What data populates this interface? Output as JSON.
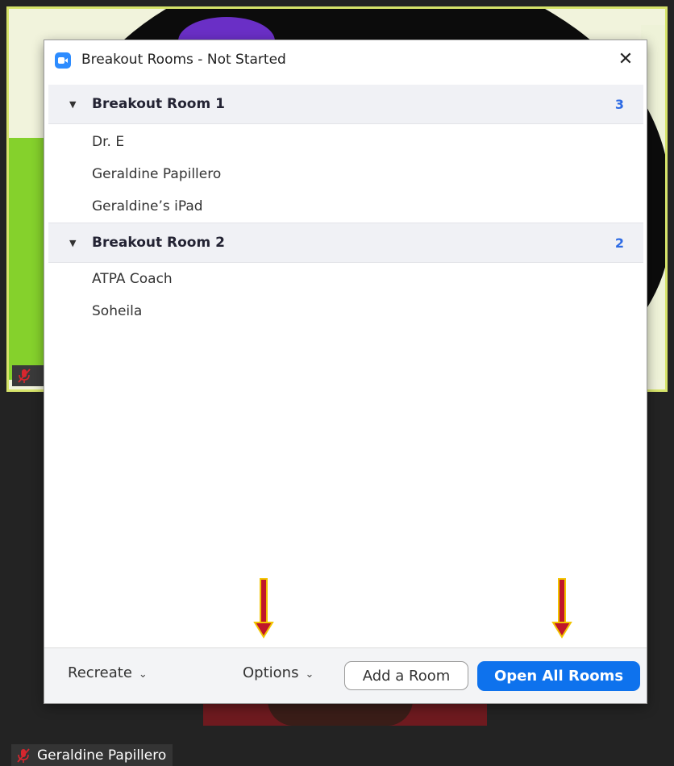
{
  "dialog": {
    "title": "Breakout Rooms - Not Started"
  },
  "rooms": [
    {
      "name": "Breakout Room 1",
      "count": "3",
      "participants": [
        "Dr. E",
        "Geraldine Papillero",
        "Geraldine’s iPad"
      ]
    },
    {
      "name": "Breakout Room 2",
      "count": "2",
      "participants": [
        "ATPA Coach",
        "Soheila"
      ]
    }
  ],
  "footer": {
    "recreate_label": "Recreate",
    "options_label": "Options",
    "add_room_label": "Add a Room",
    "open_all_label": "Open All Rooms"
  },
  "video": {
    "participant_name": "Geraldine Papillero"
  },
  "colors": {
    "accent": "#0e72ed",
    "count": "#2d6be4",
    "highlight_border": "#d6e36a",
    "arrow_fill": "#c0162a",
    "arrow_outline": "#f2c400"
  },
  "icons": [
    "zoom-logo-icon",
    "close-icon",
    "caret-down-icon",
    "chevron-down-icon",
    "mic-muted-icon",
    "arrow-down-icon"
  ]
}
